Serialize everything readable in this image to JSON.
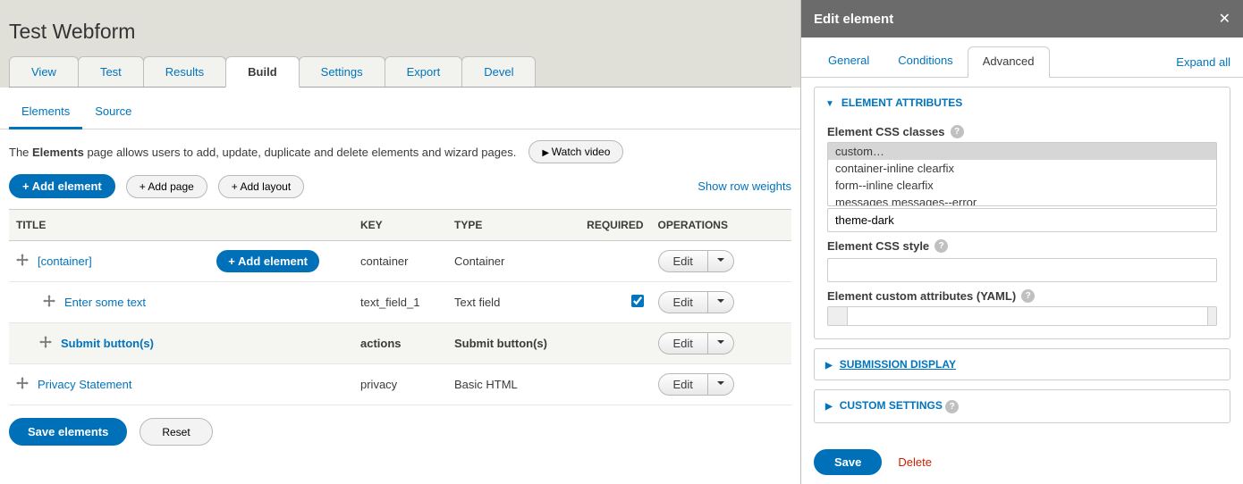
{
  "page": {
    "title": "Test Webform"
  },
  "tabs": {
    "primary": [
      "View",
      "Test",
      "Results",
      "Build",
      "Settings",
      "Export",
      "Devel"
    ],
    "primary_active": 3,
    "secondary": [
      "Elements",
      "Source"
    ],
    "secondary_active": 0
  },
  "intro": {
    "prefix": "The ",
    "bold": "Elements",
    "rest": " page allows users to add, update, duplicate and delete elements and wizard pages.",
    "watch": "Watch video"
  },
  "actions": {
    "add_element": "+ Add element",
    "add_page": "+ Add page",
    "add_layout": "+ Add layout",
    "show_weights": "Show row weights"
  },
  "table": {
    "headers": {
      "title": "TITLE",
      "key": "KEY",
      "type": "TYPE",
      "required": "REQUIRED",
      "ops": "OPERATIONS"
    },
    "rows": [
      {
        "indent": 0,
        "title": "[container]",
        "key": "container",
        "type": "Container",
        "required": false,
        "has_add": true,
        "bold": false
      },
      {
        "indent": 1,
        "title": "Enter some text",
        "key": "text_field_1",
        "type": "Text field",
        "required": true,
        "has_add": false,
        "bold": false
      },
      {
        "indent": 1,
        "title": "Submit button(s)",
        "key": "actions",
        "type": "Submit button(s)",
        "required": false,
        "has_add": false,
        "bold": true,
        "highlight": true
      },
      {
        "indent": 0,
        "title": "Privacy Statement",
        "key": "privacy",
        "type": "Basic HTML",
        "required": false,
        "has_add": false,
        "bold": false
      }
    ],
    "edit": "Edit",
    "add_inline": "+ Add element"
  },
  "footer": {
    "save": "Save elements",
    "reset": "Reset"
  },
  "sidebar": {
    "title": "Edit element",
    "tabs": [
      "General",
      "Conditions",
      "Advanced"
    ],
    "active": 2,
    "expand_all": "Expand all",
    "sections": {
      "attrs": {
        "heading": "Element Attributes",
        "css_classes_label": "Element CSS classes",
        "listbox": [
          "custom…",
          "container-inline clearfix",
          "form--inline clearfix",
          "messages messages--error"
        ],
        "selected": 0,
        "css_class_value": "theme-dark",
        "css_style_label": "Element CSS style",
        "css_style_value": "",
        "yaml_label": "Element custom attributes (YAML)"
      },
      "submission": "Submission Display",
      "custom": "Custom Settings"
    },
    "footer": {
      "save": "Save",
      "delete": "Delete"
    }
  }
}
